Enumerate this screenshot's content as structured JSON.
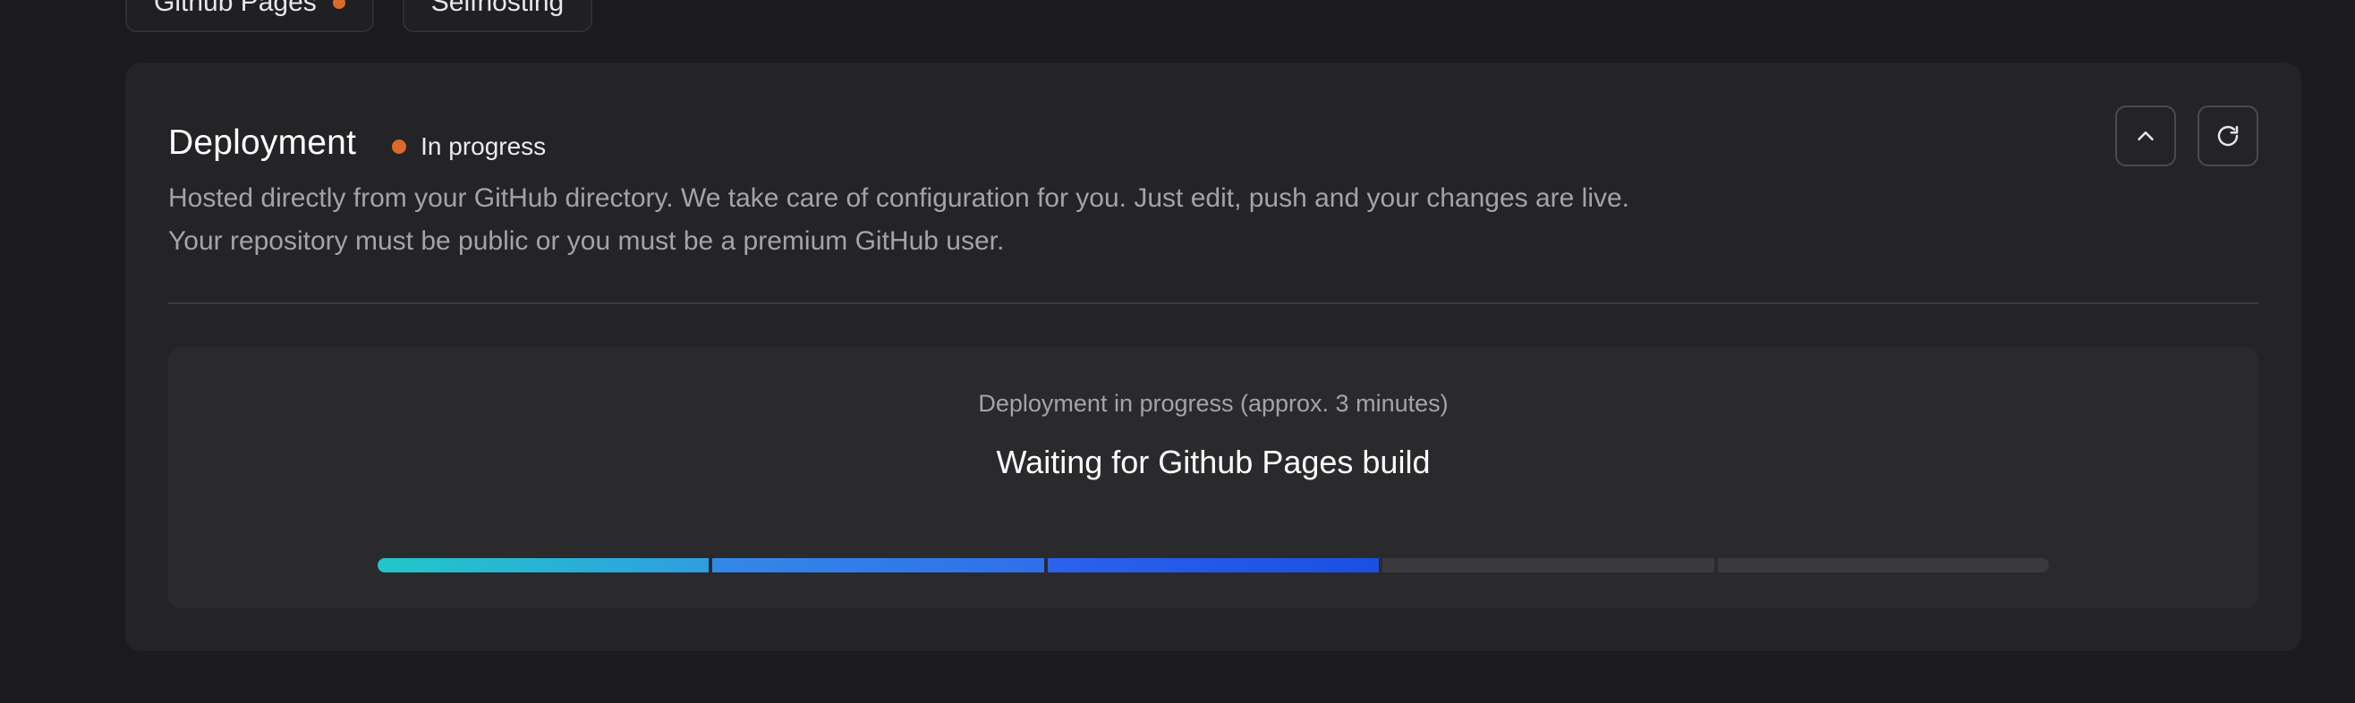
{
  "tabs": [
    {
      "label": "Github Pages",
      "has_dot": true
    },
    {
      "label": "Selfhosting",
      "has_dot": false
    }
  ],
  "deployment": {
    "title": "Deployment",
    "status": "In progress",
    "status_color": "#d96a2b",
    "description_line1": "Hosted directly from your GitHub directory. We take care of configuration for you. Just edit, push and your changes are live.",
    "description_line2": "Your repository must be public or you must be a premium GitHub user.",
    "collapse_icon": "chevron-up-icon",
    "refresh_icon": "refresh-icon"
  },
  "progress_panel": {
    "subtitle": "Deployment in progress (approx. 3 minutes)",
    "message": "Waiting for Github Pages build",
    "steps_total": 5,
    "steps_completed": 3,
    "colors": {
      "complete_start": "#21c7c9",
      "complete_end": "#1a4fe2",
      "pending": "#3a3a3e"
    }
  }
}
